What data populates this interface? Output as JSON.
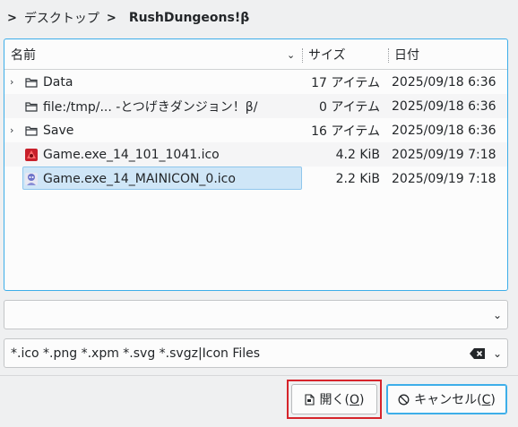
{
  "breadcrumb": {
    "parent": "デスクトップ",
    "current": "RushDungeons!β"
  },
  "columns": {
    "name": "名前",
    "size": "サイズ",
    "date": "日付"
  },
  "files": [
    {
      "name": "Data",
      "size": "17 アイテム",
      "date": "2025/09/18 6:36",
      "type": "folder",
      "expandable": true
    },
    {
      "name": "file:/tmp/...  -とつげきダンジョン！β/",
      "size": "0 アイテム",
      "date": "2025/09/18 6:36",
      "type": "folder",
      "expandable": false
    },
    {
      "name": "Save",
      "size": "16 アイテム",
      "date": "2025/09/18 6:36",
      "type": "folder",
      "expandable": true
    },
    {
      "name": "Game.exe_14_101_1041.ico",
      "size": "4.2 KiB",
      "date": "2025/09/19 7:18",
      "type": "ico-red",
      "expandable": false
    },
    {
      "name": "Game.exe_14_MAINICON_0.ico",
      "size": "2.2 KiB",
      "date": "2025/09/19 7:18",
      "type": "ico-main",
      "expandable": false,
      "selected": true
    }
  ],
  "location_input": {
    "value": ""
  },
  "filter": {
    "value": "*.ico *.png *.xpm *.svg *.svgz|Icon Files"
  },
  "buttons": {
    "open_label_pre": "開く(",
    "open_mnemonic": "O",
    "open_label_post": ")",
    "cancel_label_pre": "キャンセル(",
    "cancel_mnemonic": "C",
    "cancel_label_post": ")"
  },
  "colors": {
    "accent": "#3daee9",
    "selection": "#cfe6f7",
    "highlight": "#d6242b"
  }
}
